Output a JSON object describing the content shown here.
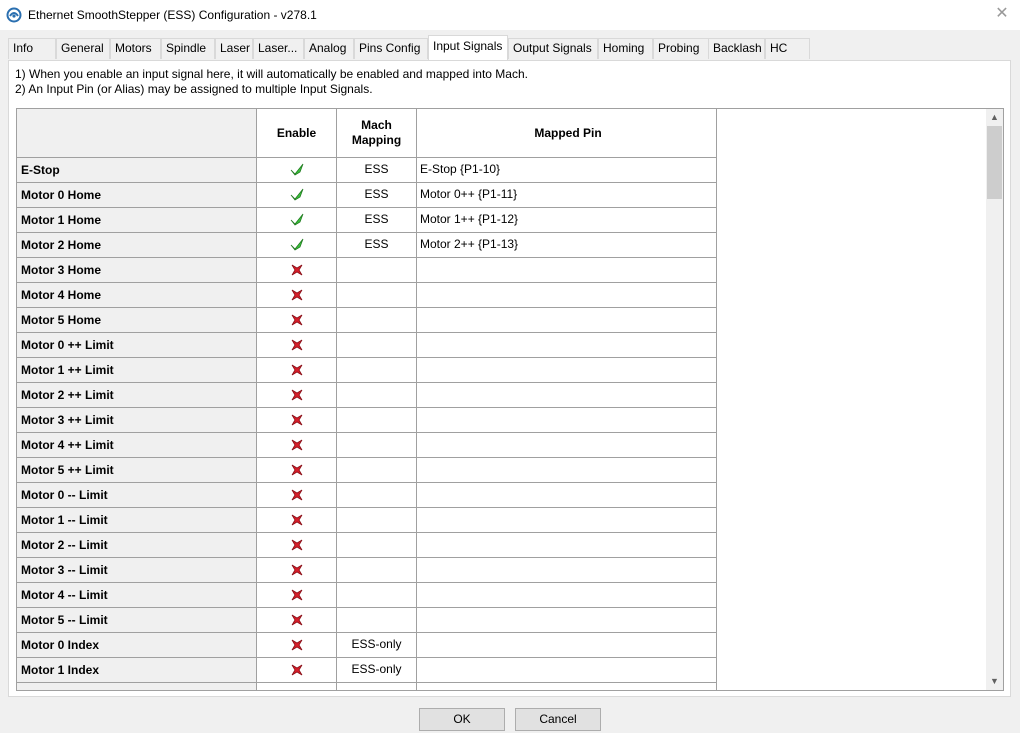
{
  "window": {
    "title": "Ethernet SmoothStepper (ESS) Configuration - v278.1",
    "close_glyph": "✕"
  },
  "tabs": [
    {
      "label": "Info"
    },
    {
      "label": "General"
    },
    {
      "label": "Motors"
    },
    {
      "label": "Spindle"
    },
    {
      "label": "Laser"
    },
    {
      "label": "Laser..."
    },
    {
      "label": "Analog"
    },
    {
      "label": "Pins Config"
    },
    {
      "label": "Input Signals"
    },
    {
      "label": "Output Signals"
    },
    {
      "label": "Homing"
    },
    {
      "label": "Probing"
    },
    {
      "label": "Backlash"
    },
    {
      "label": "HC"
    }
  ],
  "active_tab": "Input Signals",
  "notes": [
    "1) When you enable an input signal here, it will automatically be enabled and mapped into Mach.",
    "2) An Input Pin (or Alias) may be assigned to multiple Input Signals."
  ],
  "table": {
    "headers": {
      "name": "",
      "enable": "Enable",
      "mach_mapping_1": "Mach",
      "mach_mapping_2": "Mapping",
      "mapped_pin": "Mapped Pin"
    },
    "rows": [
      {
        "name": "E-Stop",
        "enabled": true,
        "mach": "ESS",
        "pin": "E-Stop {P1-10}"
      },
      {
        "name": "Motor 0 Home",
        "enabled": true,
        "mach": "ESS",
        "pin": "Motor 0++ {P1-11}"
      },
      {
        "name": "Motor 1 Home",
        "enabled": true,
        "mach": "ESS",
        "pin": "Motor 1++ {P1-12}"
      },
      {
        "name": "Motor 2 Home",
        "enabled": true,
        "mach": "ESS",
        "pin": "Motor 2++ {P1-13}"
      },
      {
        "name": "Motor 3 Home",
        "enabled": false,
        "mach": "",
        "pin": ""
      },
      {
        "name": "Motor 4 Home",
        "enabled": false,
        "mach": "",
        "pin": ""
      },
      {
        "name": "Motor 5 Home",
        "enabled": false,
        "mach": "",
        "pin": ""
      },
      {
        "name": "Motor 0 ++ Limit",
        "enabled": false,
        "mach": "",
        "pin": ""
      },
      {
        "name": "Motor 1 ++ Limit",
        "enabled": false,
        "mach": "",
        "pin": ""
      },
      {
        "name": "Motor 2 ++ Limit",
        "enabled": false,
        "mach": "",
        "pin": ""
      },
      {
        "name": "Motor 3 ++ Limit",
        "enabled": false,
        "mach": "",
        "pin": ""
      },
      {
        "name": "Motor 4 ++ Limit",
        "enabled": false,
        "mach": "",
        "pin": ""
      },
      {
        "name": "Motor 5 ++ Limit",
        "enabled": false,
        "mach": "",
        "pin": ""
      },
      {
        "name": "Motor 0 -- Limit",
        "enabled": false,
        "mach": "",
        "pin": ""
      },
      {
        "name": "Motor 1 -- Limit",
        "enabled": false,
        "mach": "",
        "pin": ""
      },
      {
        "name": "Motor 2 -- Limit",
        "enabled": false,
        "mach": "",
        "pin": ""
      },
      {
        "name": "Motor 3 -- Limit",
        "enabled": false,
        "mach": "",
        "pin": ""
      },
      {
        "name": "Motor 4 -- Limit",
        "enabled": false,
        "mach": "",
        "pin": ""
      },
      {
        "name": "Motor 5 -- Limit",
        "enabled": false,
        "mach": "",
        "pin": ""
      },
      {
        "name": "Motor 0 Index",
        "enabled": false,
        "mach": "ESS-only",
        "pin": ""
      },
      {
        "name": "Motor 1 Index",
        "enabled": false,
        "mach": "ESS-only",
        "pin": ""
      },
      {
        "name": "",
        "enabled": null,
        "mach": "",
        "pin": ""
      }
    ]
  },
  "buttons": {
    "ok": "OK",
    "cancel": "Cancel"
  },
  "colors": {
    "check": "#3cc43c",
    "cross": "#d81e2a"
  }
}
